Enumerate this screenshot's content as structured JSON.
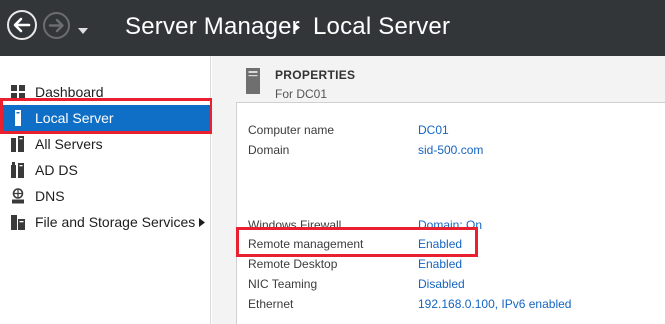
{
  "titlebar": {
    "app_title": "Server Manager",
    "page_title": "Local Server",
    "back_icon": "arrow-left-circle-icon",
    "forward_icon": "arrow-right-circle-icon",
    "dropdown_icon": "chevron-down-icon"
  },
  "sidebar": {
    "items": [
      {
        "label": "Dashboard",
        "icon": "dashboard-grid-icon",
        "selected": false
      },
      {
        "label": "Local Server",
        "icon": "server-tower-icon",
        "selected": true
      },
      {
        "label": "All Servers",
        "icon": "multiple-servers-icon",
        "selected": false
      },
      {
        "label": "AD DS",
        "icon": "ad-ds-icon",
        "selected": false
      },
      {
        "label": "DNS",
        "icon": "dns-icon",
        "selected": false
      },
      {
        "label": "File and Storage Services",
        "icon": "file-storage-icon",
        "selected": false,
        "has_submenu": true
      }
    ]
  },
  "properties": {
    "heading": "PROPERTIES",
    "subheading": "For DC01",
    "rows": [
      {
        "key": "Computer name",
        "value": "DC01"
      },
      {
        "key": "Domain",
        "value": "sid-500.com"
      },
      {
        "key": "Windows Firewall",
        "value": "Domain: On"
      },
      {
        "key": "Remote management",
        "value": "Enabled"
      },
      {
        "key": "Remote Desktop",
        "value": "Enabled"
      },
      {
        "key": "NIC Teaming",
        "value": "Disabled"
      },
      {
        "key": "Ethernet",
        "value": "192.168.0.100, IPv6 enabled"
      }
    ]
  },
  "colors": {
    "titlebar_bg": "#333638",
    "selected_bg": "#0f6fc6",
    "highlight": "#e8202f",
    "link": "#1565c0"
  }
}
